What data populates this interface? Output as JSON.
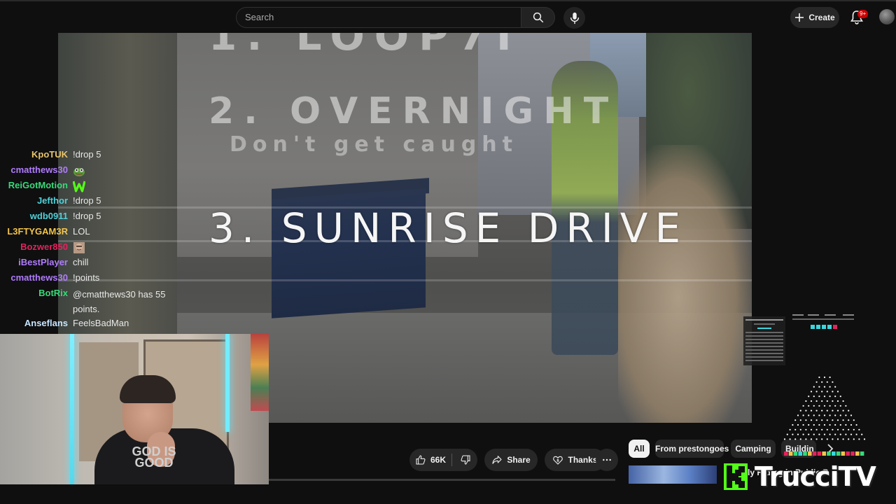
{
  "search": {
    "placeholder": "Search"
  },
  "header": {
    "create_label": "Create",
    "notifications_badge": "9+"
  },
  "video": {
    "title_overlay": "3. SUNRISE DRIVE",
    "note_line_1": "1. LOOP7I",
    "note_line_2": "2. OVERNIGHT",
    "note_line_2b": "Don't get caught"
  },
  "chat": {
    "messages": [
      {
        "user": "KpoTUK",
        "color": "#e9c46a",
        "text": "!drop 5"
      },
      {
        "user": "cmatthews30",
        "color": "#b07bff",
        "text": "",
        "emote": "pepe-emote"
      },
      {
        "user": "ReiGotMotion",
        "color": "#39d97a",
        "text": "",
        "emote": "w-emote"
      },
      {
        "user": "Jefthor",
        "color": "#4fd1d9",
        "text": "!drop 5"
      },
      {
        "user": "wdb0911",
        "color": "#4fd1d9",
        "text": "!drop 5"
      },
      {
        "user": "L3FTYGAM3R",
        "color": "#f2c44d",
        "text": "LOL"
      },
      {
        "user": "Bozwer850",
        "color": "#e0245e",
        "text": "",
        "emote": "face-emote"
      },
      {
        "user": "iBestPlayer",
        "color": "#b07bff",
        "text": "chill"
      },
      {
        "user": "cmatthews30",
        "color": "#b07bff",
        "text": "!points"
      },
      {
        "user": "BotRix",
        "color": "#39d97a",
        "text": "@cmatthews30 has 55 points."
      },
      {
        "user": "Anseflans",
        "color": "#c8e6ff",
        "text": "FeelsBadMan"
      }
    ]
  },
  "webcam": {
    "shirt_text": "GOD IS GOOD"
  },
  "actions": {
    "like_count": "66K",
    "share_label": "Share",
    "thanks_label": "Thanks"
  },
  "chips": [
    "All",
    "From prestongoes",
    "Camping",
    "Buildin"
  ],
  "recommendation": {
    "title": "Illegally Hiding in Public Places!"
  },
  "brand": {
    "name": "TrucciTV"
  },
  "colors": {
    "background": "#0f0f0f",
    "chip_active": "#f1f1f1",
    "kick_green": "#53fc18",
    "badge_red": "#cc0000"
  }
}
